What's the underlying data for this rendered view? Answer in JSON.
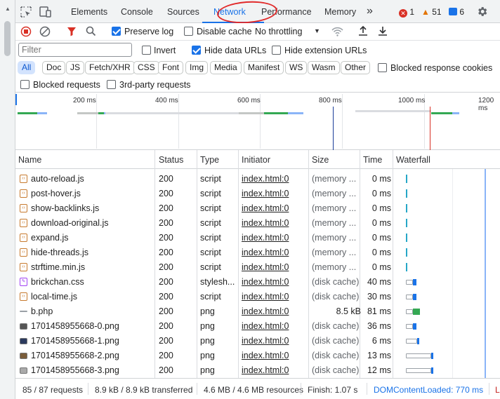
{
  "tabs": [
    "Elements",
    "Console",
    "Sources",
    "Network",
    "Performance",
    "Memory"
  ],
  "more_tabs_glyph": "»",
  "badges": {
    "errors": "1",
    "warnings": "51",
    "messages": "6"
  },
  "toolbar": {
    "preserve_log": "Preserve log",
    "preserve_log_checked": true,
    "disable_cache": "Disable cache",
    "disable_cache_checked": false,
    "throttling": "No throttling"
  },
  "filter": {
    "placeholder": "Filter",
    "invert": "Invert",
    "invert_checked": false,
    "hide_data_urls": "Hide data URLs",
    "hide_data_urls_checked": true,
    "hide_extension_urls": "Hide extension URLs",
    "hide_extension_urls_checked": false
  },
  "type_filters": [
    "All",
    "Doc",
    "JS",
    "Fetch/XHR",
    "CSS",
    "Font",
    "Img",
    "Media",
    "Manifest",
    "WS",
    "Wasm",
    "Other"
  ],
  "active_type_filter": "All",
  "blocked_response_cookies": "Blocked response cookies",
  "blocked_requests": "Blocked requests",
  "third_party_requests": "3rd-party requests",
  "overview_ticks": [
    "200 ms",
    "400 ms",
    "600 ms",
    "800 ms",
    "1000 ms",
    "1200 ms"
  ],
  "columns": [
    "Name",
    "Status",
    "Type",
    "Initiator",
    "Size",
    "Time",
    "Waterfall"
  ],
  "requests": [
    {
      "name": "auto-reload.js",
      "status": "200",
      "type": "script",
      "initiator": "index.html:0",
      "size": "(memory ...",
      "time": "0 ms",
      "kind": "js"
    },
    {
      "name": "post-hover.js",
      "status": "200",
      "type": "script",
      "initiator": "index.html:0",
      "size": "(memory ...",
      "time": "0 ms",
      "kind": "js"
    },
    {
      "name": "show-backlinks.js",
      "status": "200",
      "type": "script",
      "initiator": "index.html:0",
      "size": "(memory ...",
      "time": "0 ms",
      "kind": "js"
    },
    {
      "name": "download-original.js",
      "status": "200",
      "type": "script",
      "initiator": "index.html:0",
      "size": "(memory ...",
      "time": "0 ms",
      "kind": "js"
    },
    {
      "name": "expand.js",
      "status": "200",
      "type": "script",
      "initiator": "index.html:0",
      "size": "(memory ...",
      "time": "0 ms",
      "kind": "js"
    },
    {
      "name": "hide-threads.js",
      "status": "200",
      "type": "script",
      "initiator": "index.html:0",
      "size": "(memory ...",
      "time": "0 ms",
      "kind": "js"
    },
    {
      "name": "strftime.min.js",
      "status": "200",
      "type": "script",
      "initiator": "index.html:0",
      "size": "(memory ...",
      "time": "0 ms",
      "kind": "js"
    },
    {
      "name": "brickchan.css",
      "status": "200",
      "type": "stylesh...",
      "initiator": "index.html:0",
      "size": "(disk cache)",
      "time": "40 ms",
      "kind": "css"
    },
    {
      "name": "local-time.js",
      "status": "200",
      "type": "script",
      "initiator": "index.html:0",
      "size": "(disk cache)",
      "time": "30 ms",
      "kind": "js"
    },
    {
      "name": "b.php",
      "status": "200",
      "type": "png",
      "initiator": "index.html:0",
      "size": "8.5 kB",
      "time": "81 ms",
      "kind": "php"
    },
    {
      "name": "1701458955668-0.png",
      "status": "200",
      "type": "png",
      "initiator": "index.html:0",
      "size": "(disk cache)",
      "time": "36 ms",
      "kind": "img"
    },
    {
      "name": "1701458955668-1.png",
      "status": "200",
      "type": "png",
      "initiator": "index.html:0",
      "size": "(disk cache)",
      "time": "6 ms",
      "kind": "img"
    },
    {
      "name": "1701458955668-2.png",
      "status": "200",
      "type": "png",
      "initiator": "index.html:0",
      "size": "(disk cache)",
      "time": "13 ms",
      "kind": "img"
    },
    {
      "name": "1701458955668-3.png",
      "status": "200",
      "type": "png",
      "initiator": "index.html:0",
      "size": "(disk cache)",
      "time": "12 ms",
      "kind": "img"
    }
  ],
  "footer": {
    "requests": "85 / 87 requests",
    "transferred": "8.9 kB / 8.9 kB transferred",
    "resources": "4.6 MB / 4.6 MB resources",
    "finish": "Finish: 1.07 s",
    "domcontentloaded": "DOMContentLoaded: 770 ms",
    "load": "L"
  }
}
